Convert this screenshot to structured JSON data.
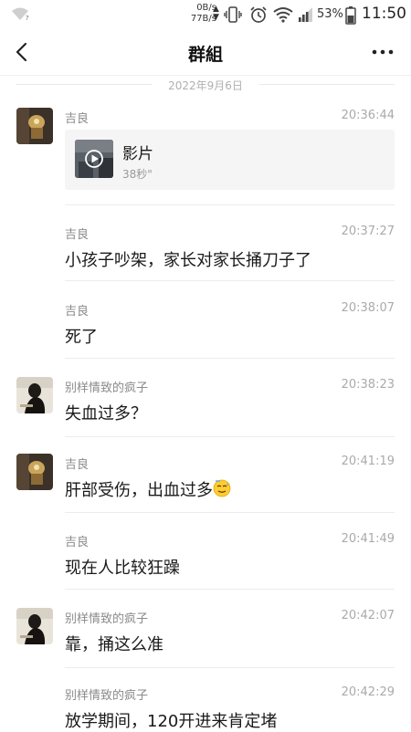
{
  "status_bar": {
    "net_down": "0B/s",
    "net_up": "77B/s",
    "battery": "53%",
    "time": "11:50"
  },
  "nav": {
    "title": "群組"
  },
  "date_separator": "2022年9月6日",
  "messages": [
    {
      "sender": "吉良",
      "time": "20:36:44",
      "video": {
        "title": "影片",
        "duration": "38秒\""
      }
    },
    {
      "sender": "吉良",
      "time": "20:37:27",
      "text": "小孩子吵架，家长对家长捅刀子了"
    },
    {
      "sender": "吉良",
      "time": "20:38:07",
      "text": "死了"
    },
    {
      "sender": "别样情致的疯子",
      "time": "20:38:23",
      "text": "失血过多？"
    },
    {
      "sender": "吉良",
      "time": "20:41:19",
      "text": "肝部受伤，出血过多"
    },
    {
      "sender": "吉良",
      "time": "20:41:49",
      "text": "现在人比较狂躁"
    },
    {
      "sender": "别样情致的疯子",
      "time": "20:42:07",
      "text": "靠，捅这么准"
    },
    {
      "sender": "别样情致的疯子",
      "time": "20:42:29",
      "text": "放学期间，120开进来肯定堵"
    }
  ]
}
